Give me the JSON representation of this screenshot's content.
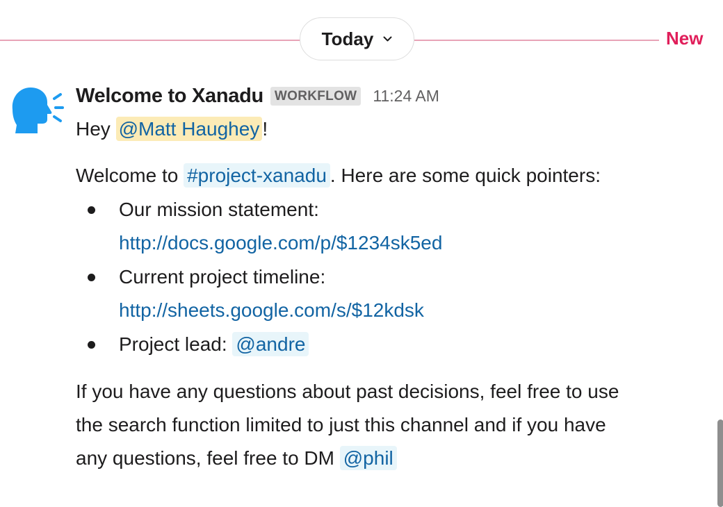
{
  "divider": {
    "day_label": "Today",
    "new_label": "New",
    "accent_color": "#e01e5a",
    "line_color": "#e8a3b7"
  },
  "message": {
    "avatar_icon": "speaking-head-icon",
    "sender": "Welcome to Xanadu",
    "badge": "WORKFLOW",
    "time": "11:24 AM",
    "greeting_prefix": "Hey ",
    "greeting_mention": "@Matt Haughey",
    "greeting_suffix": "!",
    "intro_prefix": "Welcome to ",
    "intro_channel": "#project-xanadu",
    "intro_suffix": ". Here are some quick pointers:",
    "items": [
      {
        "label": "Our mission statement:",
        "link": "http://docs.google.com/p/$1234sk5ed"
      },
      {
        "label": "Current project timeline:",
        "link": "http://sheets.google.com/s/$12kdsk"
      },
      {
        "label": "Project lead: ",
        "mention": "@andre"
      }
    ],
    "closing_line1": "If you have any questions about past decisions, feel free to use",
    "closing_line2": "the search function limited to just this channel and if you have",
    "closing_line3_prefix": "any questions, feel free to DM ",
    "closing_mention": "@phil"
  }
}
